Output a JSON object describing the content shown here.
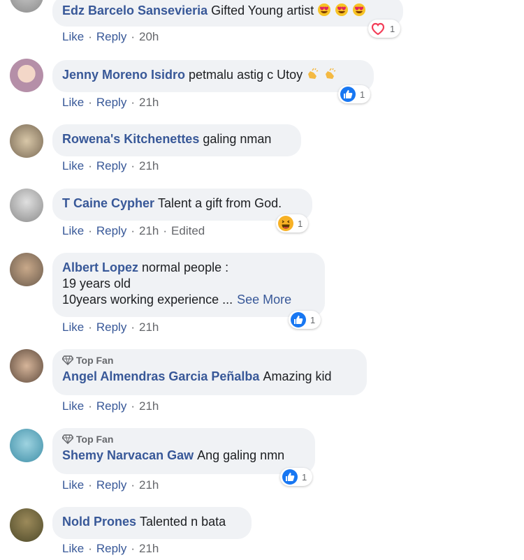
{
  "comments": [
    {
      "author": "Edz Barcelo Sansevieria",
      "text": "Gifted Young artist",
      "like": "Like",
      "reply": "Reply",
      "time": "20h",
      "reaction_count": "1"
    },
    {
      "author": "Jenny Moreno Isidro",
      "text": "petmalu astig c Utoy",
      "like": "Like",
      "reply": "Reply",
      "time": "21h",
      "reaction_count": "1"
    },
    {
      "author": "Rowena's Kitchenettes",
      "text": "galing nman",
      "like": "Like",
      "reply": "Reply",
      "time": "21h"
    },
    {
      "author": "T Caine Cypher",
      "text": "Talent a gift from God.",
      "like": "Like",
      "reply": "Reply",
      "time": "21h",
      "edited": "Edited",
      "reaction_count": "1"
    },
    {
      "author": "Albert Lopez",
      "text_line1": "normal people :",
      "text_line2": "19 years old",
      "text_line3": "10years working experience ...",
      "see_more": "See More",
      "like": "Like",
      "reply": "Reply",
      "time": "21h",
      "reaction_count": "1"
    },
    {
      "badge": "Top Fan",
      "author": "Angel Almendras Garcia Peñalba",
      "text": "Amazing kid",
      "like": "Like",
      "reply": "Reply",
      "time": "21h"
    },
    {
      "badge": "Top Fan",
      "author": "Shemy Narvacan Gaw",
      "text": "Ang galing nmn",
      "like": "Like",
      "reply": "Reply",
      "time": "21h",
      "reaction_count": "1"
    },
    {
      "author": "Nold Prones",
      "text": "Talented n bata",
      "like": "Like",
      "reply": "Reply",
      "time": "21h"
    }
  ],
  "colors": {
    "link": "#385898",
    "bubble": "#f0f2f5",
    "meta": "#65676b",
    "like_blue": "#1877f2",
    "love_red": "#f33e58",
    "haha_yellow": "#f7b125"
  },
  "icons": [
    "heart-eyes-emoji",
    "clapping-hands-emoji",
    "love-reaction-icon",
    "like-reaction-icon",
    "haha-reaction-icon",
    "top-fan-diamond-icon"
  ]
}
